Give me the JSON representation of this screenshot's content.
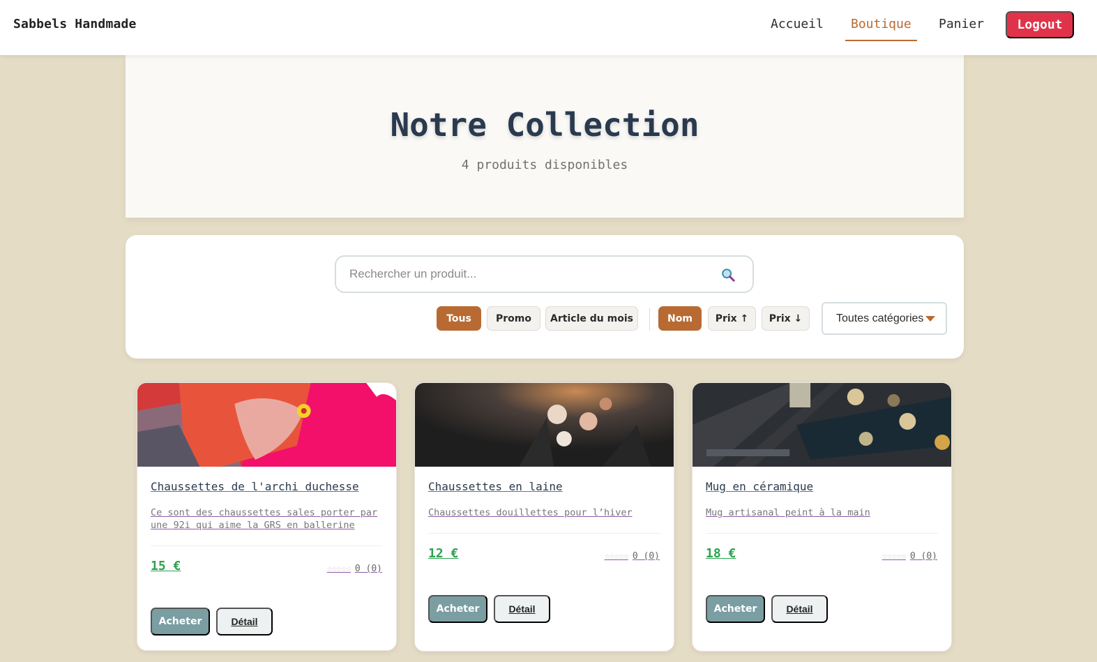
{
  "nav": {
    "brand": "Sabbels Handmade",
    "links": [
      "Accueil",
      "Boutique",
      "Panier"
    ],
    "logout": "Logout"
  },
  "hero": {
    "title": "Notre Collection",
    "subtitle": "4 produits disponibles"
  },
  "filters": {
    "search_placeholder": "Rechercher un produit...",
    "chips": [
      "Tous",
      "Promo",
      "Article du mois"
    ],
    "sorts": [
      "Nom",
      "Prix ↑",
      "Prix ↓"
    ],
    "category": "Toutes catégories"
  },
  "products": [
    {
      "title": "Chaussettes de l'archi duchesse",
      "desc": "Ce sont des chaussettes sales porter par une 92i qui aime la GRS en ballerine",
      "price": "15 €",
      "stars": "☆☆☆☆☆",
      "rating": "0 (0)",
      "buy": "Acheter",
      "detail": "Détail"
    },
    {
      "title": "Chaussettes en laine",
      "desc": "Chaussettes douillettes pour l’hiver",
      "price": "12 €",
      "stars": "☆☆☆☆☆",
      "rating": "0 (0)",
      "buy": "Acheter",
      "detail": "Détail"
    },
    {
      "title": "Mug en céramique",
      "desc": "Mug artisanal peint à la main",
      "price": "18 €",
      "stars": "☆☆☆☆☆",
      "rating": "0 (0)",
      "buy": "Acheter",
      "detail": "Détail"
    }
  ],
  "colors": {
    "accent": "#b86a32",
    "logout": "#e0334a",
    "price": "#2ea24f",
    "background": "#e5dcc6"
  }
}
